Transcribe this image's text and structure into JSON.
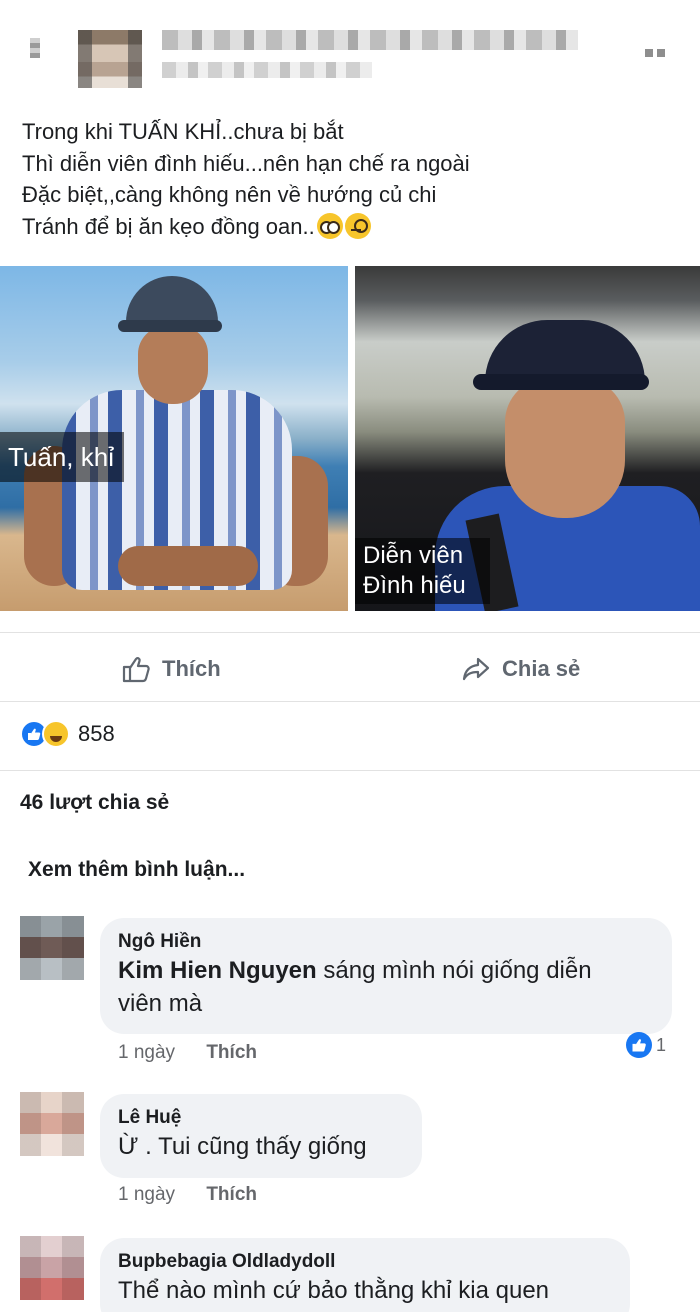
{
  "post": {
    "lines": [
      "Trong khi TUẤN KHỈ..chưa bị bắt",
      "Thì diễn viên đình hiếu...nên hạn chế ra ngoài",
      "Đặc biệt,,càng không nên về hướng củ chi",
      "Tránh để bị ăn kẹo đồng oan.."
    ]
  },
  "photos": {
    "left_caption": "Tuấn, khỉ",
    "right_caption_line1": "Diễn viên",
    "right_caption_line2": "Đình hiếu"
  },
  "actions": {
    "like_label": "Thích",
    "share_label": "Chia sẻ"
  },
  "reactions": {
    "count": "858"
  },
  "shares_text": "46 lượt chia sẻ",
  "more_comments": "Xem thêm bình luận...",
  "comments": [
    {
      "name": "Ngô Hiền",
      "mention": "Kim Hien Nguyen",
      "text_line1_rest": " sáng mình nói giống diễn",
      "text_line2": "viên mà",
      "time": "1 ngày",
      "like": "Thích",
      "reaction_count": "1"
    },
    {
      "name": "Lê Huệ",
      "text": "Ừ . Tui cũng thấy giống",
      "time": "1 ngày",
      "like": "Thích"
    },
    {
      "name": "Bupbebagia Oldladydoll",
      "text": "Thể nào mình cứ bảo thằng khỉ kia quen"
    }
  ],
  "colors": {
    "accent": "#1877f2",
    "bubble": "#f0f2f5",
    "muted": "#65676b",
    "action": "#606770"
  }
}
